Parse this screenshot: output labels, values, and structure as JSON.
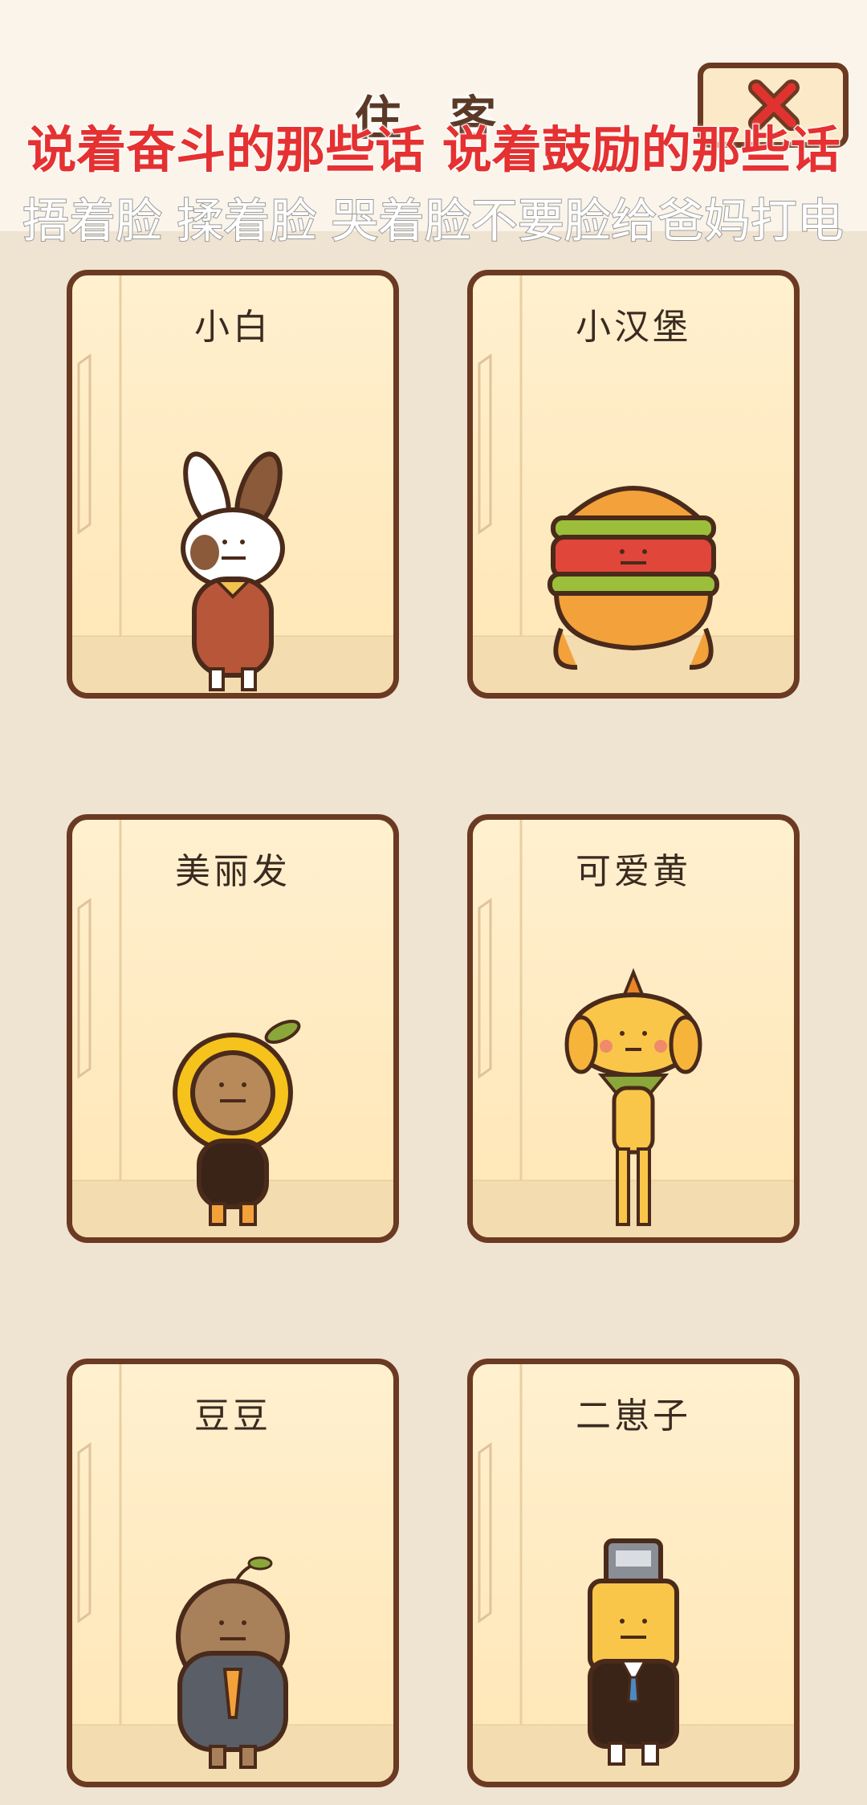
{
  "header": {
    "title": "住 客",
    "close_icon": "close-icon",
    "lyric_line_1": "说着奋斗的那些话 说着鼓励的那些话",
    "lyric_line_2": "捂着脸 揉着脸 哭着脸不要脸给爸妈打电"
  },
  "characters": [
    {
      "name": "小白",
      "icon": "bunny-character-icon"
    },
    {
      "name": "小汉堡",
      "icon": "hamburger-character-icon"
    },
    {
      "name": "美丽发",
      "icon": "sunflower-character-icon"
    },
    {
      "name": "可爱黄",
      "icon": "dog-character-icon"
    },
    {
      "name": "豆豆",
      "icon": "bean-character-icon"
    },
    {
      "name": "二崽子",
      "icon": "robot-character-icon"
    }
  ],
  "colors": {
    "page_bg": "#efe3d1",
    "card_border": "#6b3a22",
    "lyric_red": "#e53131"
  }
}
